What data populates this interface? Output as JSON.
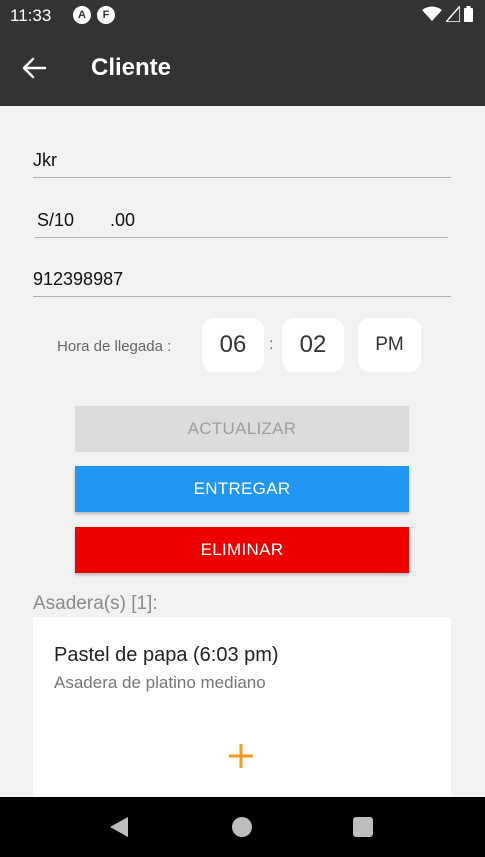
{
  "status": {
    "time": "11:33",
    "app_icons": [
      "A",
      "F"
    ]
  },
  "appbar": {
    "title": "Cliente"
  },
  "form": {
    "name": "Jkr",
    "price_prefix": "S/10",
    "price_value": ".00",
    "phone": "912398987",
    "arrival_label": "Hora de llegada :",
    "hour": "06",
    "separator": ":",
    "minute": "02",
    "period": "PM"
  },
  "buttons": {
    "update": "ACTUALIZAR",
    "deliver": "ENTREGAR",
    "delete": "ELIMINAR"
  },
  "colors": {
    "deliver": "#2196f3",
    "delete": "#ee0000",
    "add": "#f59a23",
    "appbar": "#333333"
  },
  "trays": {
    "title": "Asadera(s) [1]:",
    "items": [
      {
        "title": "Pastel de papa (6:03 pm)",
        "subtitle": "Asadera de platino mediano"
      }
    ]
  }
}
